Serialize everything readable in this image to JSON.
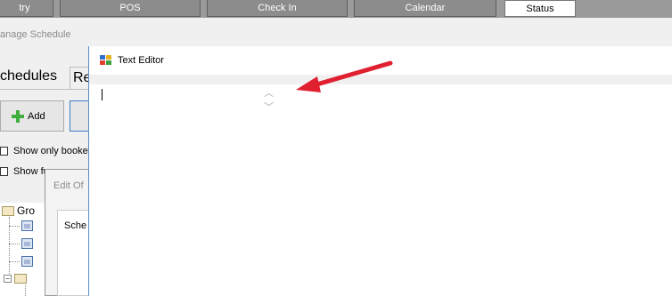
{
  "topbar": {
    "buttons": [
      {
        "label": "try"
      },
      {
        "label": "POS"
      },
      {
        "label": "Check In"
      },
      {
        "label": "Calendar"
      },
      {
        "label": "Status"
      }
    ]
  },
  "breadcrumb": "anage Schedule",
  "tabs": {
    "first": "chedules",
    "second": "Re"
  },
  "toolbar": {
    "add_label": "Add"
  },
  "checkboxes": [
    {
      "label": "Show only booke"
    },
    {
      "label": "Show fu"
    }
  ],
  "edit_dialog": {
    "title": "Edit Of",
    "schedule_label": "Sche"
  },
  "tree": {
    "root_label": "Gro"
  },
  "editor": {
    "title": "Text Editor"
  },
  "colors": {
    "arrow": "#e02030",
    "accent": "#5a8fd0"
  }
}
